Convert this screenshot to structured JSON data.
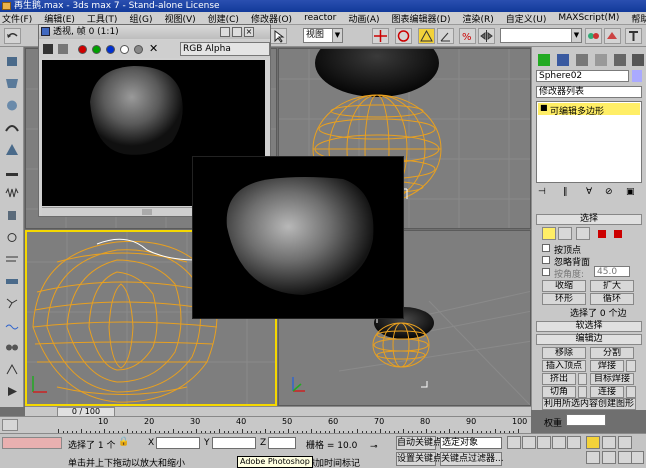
{
  "window": {
    "title": "再生鹅.max - 3ds max 7 - Stand-alone License"
  },
  "menu": [
    "文件(F)",
    "编辑(E)",
    "工具(T)",
    "组(G)",
    "视图(V)",
    "创建(C)",
    "修改器(O)",
    "reactor",
    "动画(A)",
    "图表编辑器(D)",
    "渲染(R)",
    "自定义(U)",
    "MAXScript(M)",
    "帮助(H)"
  ],
  "toolbar": {
    "view_combo": "视图",
    "icons": [
      "undo-icon",
      "redo-icon",
      "select-icon",
      "move-icon",
      "rotate-icon",
      "scale-icon",
      "snap-icon",
      "angle-snap-icon",
      "percent-snap-icon",
      "mirror-icon",
      "align-icon",
      "material-editor-icon",
      "render-icon"
    ]
  },
  "render_window": {
    "title": "透视, 帧 0 (1:1)",
    "channel": "RGB Alpha",
    "colors": [
      "#d00000",
      "#00a000",
      "#0030d0",
      "#ffffff",
      "#888888"
    ]
  },
  "command_panel": {
    "object_name": "Sphere02",
    "modifier_list": "修改器列表",
    "stack_item": "可编辑多边形",
    "selection_rollout": "选择",
    "by_vertex": "按顶点",
    "ignore_backfacing": "忽略背面",
    "by_angle": "按角度:",
    "angle_value": "45.0",
    "shrink": "收缩",
    "grow": "扩大",
    "ring": "环形",
    "loop": "循环",
    "selected_count": "选择了 0 个边",
    "soft_selection": "软选择",
    "edit_edges": "编辑边",
    "remove": "移除",
    "split": "分割",
    "insert_vertex": "插入顶点",
    "weld": "焊接",
    "extrude": "挤出",
    "target_weld": "目标焊接",
    "chamfer": "切角",
    "connect": "连接",
    "create_shape": "利用所选内容创建图形",
    "weight": "权重"
  },
  "timeline": {
    "slider_label": "0 / 100",
    "ticks": [
      "10",
      "20",
      "30",
      "40",
      "50",
      "60",
      "70",
      "80",
      "90",
      "100"
    ]
  },
  "status": {
    "selected": "选择了 1 个",
    "x_label": "X",
    "y_label": "Y",
    "z_label": "Z",
    "grid": "栅格 = 10.0",
    "auto_key": "自动关键点",
    "selected_object": "选定对象",
    "set_key": "设置关键点",
    "key_filters": "关键点过滤器...",
    "prompt": "单击并上下拖动以放大和缩小",
    "add_time_tag": "添加时间标记",
    "tooltip": "Adobe Photoshop"
  }
}
